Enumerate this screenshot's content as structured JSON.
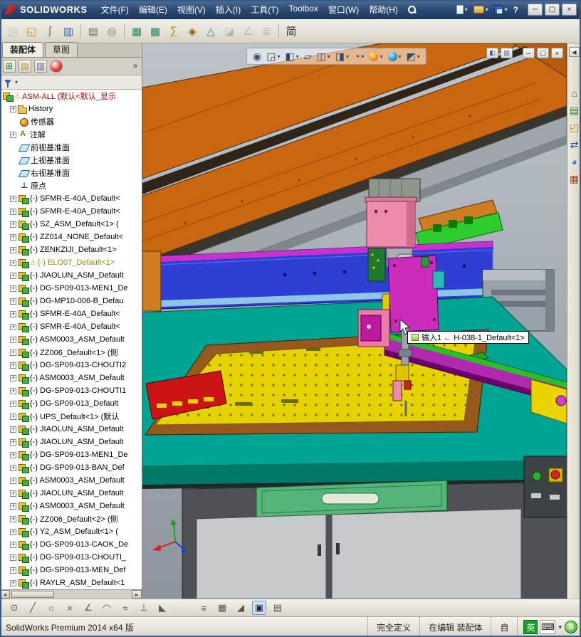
{
  "window": {
    "brand": "SOLIDWORKS",
    "menus": [
      "文件(F)",
      "编辑(E)",
      "视图(V)",
      "插入(I)",
      "工具(T)",
      "Toolbox",
      "窗口(W)",
      "帮助(H)"
    ],
    "quick": [
      {
        "name": "new-document-button",
        "icon": "qnew",
        "caret": true
      },
      {
        "name": "open-document-button",
        "icon": "qopen",
        "caret": true
      },
      {
        "name": "save-button",
        "icon": "qsave",
        "caret": true
      },
      {
        "name": "help-button",
        "text": "?"
      }
    ],
    "controls": [
      {
        "name": "minimize-button",
        "glyph": "─"
      },
      {
        "name": "maximize-button",
        "glyph": "▢"
      },
      {
        "name": "close-button",
        "glyph": "×"
      }
    ]
  },
  "toolbar": [
    {
      "name": "edit-component-icon",
      "glyph": "◳",
      "color": "#9aa0a6",
      "disabled": true
    },
    {
      "name": "insert-component-icon",
      "glyph": "◱",
      "color": "#c89028"
    },
    {
      "name": "attachment-icon",
      "glyph": "ʃ",
      "color": "#707070"
    },
    {
      "name": "component-preview-icon",
      "glyph": "▥",
      "color": "#3a62b0"
    },
    {
      "sep": true
    },
    {
      "name": "print-icon",
      "glyph": "▤",
      "color": "#6a7078"
    },
    {
      "name": "evaluate-icon",
      "glyph": "◎",
      "color": "#8a6a30"
    },
    {
      "sep": true
    },
    {
      "name": "bom-table-icon",
      "glyph": "▦",
      "color": "#2a8a5a"
    },
    {
      "name": "design-table-icon",
      "glyph": "▩",
      "color": "#2a8a5a"
    },
    {
      "name": "equations-icon",
      "glyph": "∑",
      "color": "#b09000"
    },
    {
      "name": "smart-fastener-icon",
      "glyph": "◈",
      "color": "#a05818"
    },
    {
      "name": "exploded-view-icon",
      "glyph": "△",
      "color": "#3a7ab0"
    },
    {
      "name": "interference-check-icon",
      "glyph": "◪",
      "color": "#888888",
      "disabled": true
    },
    {
      "name": "measure-icon",
      "glyph": "∠",
      "color": "#888888",
      "disabled": true
    },
    {
      "name": "mass-properties-icon",
      "glyph": "≣",
      "color": "#888888",
      "disabled": true
    },
    {
      "sep": true
    },
    {
      "name": "language-pack-icon",
      "glyph": "简",
      "color": "#333333"
    }
  ],
  "panel": {
    "tabs": [
      {
        "label": "装配体",
        "active": true
      },
      {
        "label": "草图",
        "active": false
      }
    ],
    "chevron": "»",
    "managers": [
      {
        "name": "featuremanager-tab-icon",
        "glyph": "⊞",
        "color": "#2a8a2a"
      },
      {
        "name": "propertymanager-tab-icon",
        "glyph": "▤",
        "color": "#b08a30"
      },
      {
        "name": "configurationmanager-tab-icon",
        "glyph": "▥",
        "color": "#6a5aa0"
      },
      {
        "name": "dimxpert-tab-icon",
        "ball": true
      }
    ],
    "tree": {
      "root": {
        "label": "ASM-ALL (默认<默认_显示",
        "warning": true
      },
      "items": [
        {
          "icon": "history",
          "label": "History"
        },
        {
          "icon": "sensor",
          "label": "传感器"
        },
        {
          "icon": "annotation",
          "label": "注解"
        },
        {
          "icon": "plane",
          "label": "前视基准面"
        },
        {
          "icon": "plane",
          "label": "上视基准面"
        },
        {
          "icon": "plane",
          "label": "右视基准面"
        },
        {
          "icon": "origin",
          "label": "原点"
        },
        {
          "icon": "component",
          "label": "(-) SFMR-E-40A_Default<"
        },
        {
          "icon": "component",
          "label": "(-) SFMR-E-40A_Default<"
        },
        {
          "icon": "component",
          "label": "(-) SZ_ASM_Default<1> ("
        },
        {
          "icon": "component",
          "label": "(-) ZZ014_NONE_Default<"
        },
        {
          "icon": "component",
          "label": "(-) ZENKZIJI_Default<1>"
        },
        {
          "icon": "component",
          "label": "(-) ELO07_Default<1>",
          "warning": true
        },
        {
          "icon": "component",
          "label": "(-) JIAOLUN_ASM_Default"
        },
        {
          "icon": "component",
          "label": "(-) DG-SP09-013-MEN1_De"
        },
        {
          "icon": "component",
          "label": "(-) DG-MP10-006-B_Defau"
        },
        {
          "icon": "component",
          "label": "(-) SFMR-E-40A_Default<"
        },
        {
          "icon": "component",
          "label": "(-) SFMR-E-40A_Default<"
        },
        {
          "icon": "component",
          "label": "(-) ASM0003_ASM_Default"
        },
        {
          "icon": "component",
          "label": "(-) ZZ006_Default<1> (侧"
        },
        {
          "icon": "component",
          "label": "(-) DG-SP09-013-CHOUTI2"
        },
        {
          "icon": "component",
          "label": "(-) ASM0003_ASM_Default"
        },
        {
          "icon": "component",
          "label": "(-) DG-SP09-013-CHOUTI1"
        },
        {
          "icon": "component",
          "label": "(-) DG-SP09-013_Default"
        },
        {
          "icon": "component",
          "label": "(-) UPS_Default<1> (默认"
        },
        {
          "icon": "component",
          "label": "(-) JIAOLUN_ASM_Default"
        },
        {
          "icon": "component",
          "label": "(-) JIAOLUN_ASM_Default"
        },
        {
          "icon": "component",
          "label": "(-) DG-SP09-013-MEN1_De"
        },
        {
          "icon": "component",
          "label": "(-) DG-SP09-013-BAN_Def"
        },
        {
          "icon": "component",
          "label": "(-) ASM0003_ASM_Default"
        },
        {
          "icon": "component",
          "label": "(-) JIAOLUN_ASM_Default"
        },
        {
          "icon": "component",
          "label": "(-) ASM0003_ASM_Default"
        },
        {
          "icon": "component",
          "label": "(-) ZZ006_Default<2> (侧"
        },
        {
          "icon": "component",
          "label": "(-) Y2_ASM_Default<1> ("
        },
        {
          "icon": "component",
          "label": "(-) DG-SP09-013-CAOK_De"
        },
        {
          "icon": "component",
          "label": "(-) DG-SP09-013-CHOUTI_"
        },
        {
          "icon": "component",
          "label": "(-) DG-SP09-013-MEN_Def"
        },
        {
          "icon": "component",
          "label": "(-) RAYLR_ASM_Default<1"
        }
      ]
    }
  },
  "viewport": {
    "tooltip": {
      "text": "输入1 ← H-038-1_Default<1>"
    },
    "headsup": [
      {
        "name": "zoom-fit-icon",
        "glyph": "◉"
      },
      {
        "name": "zoom-area-icon",
        "glyph": "◲",
        "caret": true
      },
      {
        "name": "section-view-icon",
        "glyph": "◧",
        "caret": true
      },
      {
        "name": "measure-icon",
        "glyph": "▱"
      },
      {
        "name": "view-orientation-icon",
        "glyph": "◫",
        "caret": true
      },
      {
        "name": "display-style-icon",
        "glyph": "◨",
        "caret": true
      },
      {
        "name": "hide-show-items-icon",
        "glyph": "◔",
        "caret": true
      },
      {
        "name": "edit-appearance-icon",
        "ball": "warm",
        "caret": true
      },
      {
        "name": "apply-scene-icon",
        "ball": "cool",
        "caret": true
      },
      {
        "name": "view-settings-icon",
        "glyph": "◩",
        "caret": true
      }
    ],
    "pane_toggles": [
      {
        "name": "show-featuremanager-pane-icon",
        "glyph": "◧"
      },
      {
        "name": "show-display-pane-icon",
        "glyph": "▥"
      }
    ],
    "window_buttons": [
      {
        "name": "doc-minimize-button",
        "glyph": "─"
      },
      {
        "name": "doc-restore-button",
        "glyph": "▢"
      },
      {
        "name": "doc-close-button",
        "glyph": "×"
      }
    ]
  },
  "taskpane": [
    {
      "name": "home-icon",
      "glyph": "⌂",
      "color": "#8a4a10"
    },
    {
      "name": "design-library-icon",
      "glyph": "▤",
      "color": "#2a7a3a"
    },
    {
      "name": "file-explorer-icon",
      "glyph": "◰",
      "color": "#c08820"
    },
    {
      "name": "view-palette-icon",
      "glyph": "⇄",
      "color": "#2050b0"
    },
    {
      "name": "appearances-scenes-icon",
      "glyph": "◕",
      "color": "#2080c0"
    },
    {
      "name": "custom-properties-icon",
      "glyph": "▦",
      "color": "#b04a20"
    }
  ],
  "sketchbar": [
    {
      "name": "point-icon",
      "glyph": "⊙"
    },
    {
      "name": "line-icon",
      "glyph": "╱"
    },
    {
      "name": "circle-icon",
      "glyph": "○"
    },
    {
      "name": "trim-icon",
      "glyph": "×"
    },
    {
      "name": "angle-icon",
      "glyph": "∠"
    },
    {
      "name": "arc-icon",
      "glyph": "◠"
    },
    {
      "name": "spline-icon",
      "glyph": "≈"
    },
    {
      "name": "perpendicular-icon",
      "glyph": "⊥"
    },
    {
      "name": "corner-icon",
      "glyph": "◣"
    },
    {
      "sep": true
    },
    {
      "name": "snap-icon",
      "glyph": "≡"
    },
    {
      "name": "grid-icon",
      "glyph": "▦"
    },
    {
      "name": "slope-icon",
      "glyph": "◢"
    },
    {
      "name": "quick-snaps-icon",
      "glyph": "▣",
      "active": true
    },
    {
      "name": "table-icon",
      "glyph": "▤"
    }
  ],
  "statusbar": {
    "left": "SolidWorks Premium 2014 x64 版",
    "cells": [
      {
        "name": "status-fully-defined",
        "label": "完全定义"
      },
      {
        "name": "status-editing-assembly",
        "label": "在编辑 装配体"
      },
      {
        "name": "status-custom",
        "label": "自"
      }
    ],
    "lang": [
      {
        "name": "language-english-badge",
        "cls": "lang-en",
        "text": "英"
      },
      {
        "name": "keyboard-icon",
        "cls": "lang-kb",
        "text": "⌨"
      },
      {
        "name": "language-options-icon",
        "cls": "lang-caret",
        "text": "▾"
      },
      {
        "name": "ime-icon",
        "cls": "lang-s",
        "text": "S"
      }
    ]
  },
  "colors": {
    "titlebar": "#28466f",
    "roof_orange": "#c9660f",
    "beam_blue": "#2f3fd4",
    "table_teal": "#00a493",
    "plate_yellow": "#e6d200",
    "plate_red": "#cc1414",
    "zaxis_pink": "#f08cab",
    "rail_magenta": "#b02ab0"
  }
}
